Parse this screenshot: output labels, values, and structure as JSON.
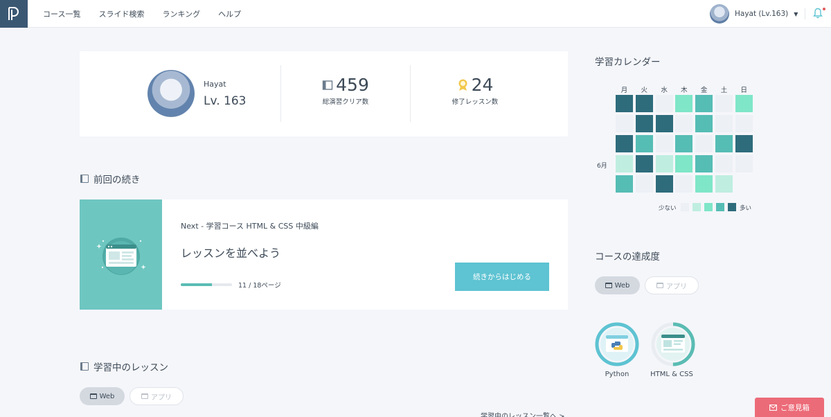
{
  "nav": {
    "items": [
      "コース一覧",
      "スライド検索",
      "ランキング",
      "ヘルプ"
    ]
  },
  "user": {
    "label": "Hayat (Lv.163)"
  },
  "profile": {
    "name": "Hayat",
    "level": "Lv. 163",
    "stats": [
      {
        "value": "459",
        "label": "総演習クリア数"
      },
      {
        "value": "24",
        "label": "修了レッスン数"
      }
    ]
  },
  "continue": {
    "title": "前回の続き",
    "next": "Next - 学習コース HTML & CSS 中級編",
    "lesson": "レッスンを並べよう",
    "progress": 0.6111,
    "pages": "11 / 18ページ",
    "button": "続きからはじめる"
  },
  "learning": {
    "title": "学習中のレッスン",
    "tabs": [
      "Web",
      "アプリ"
    ],
    "more": "学習中のレッスン一覧へ >"
  },
  "calendar": {
    "title": "学習カレンダー",
    "days": [
      "月",
      "火",
      "水",
      "木",
      "金",
      "土",
      "日"
    ],
    "month": "6月",
    "levels": [
      [
        4,
        4,
        0,
        2,
        3,
        0,
        2
      ],
      [
        0,
        4,
        4,
        0,
        3,
        0,
        0
      ],
      [
        4,
        3,
        0,
        3,
        0,
        3,
        4
      ],
      [
        1,
        4,
        1,
        2,
        3,
        0,
        0
      ],
      [
        3,
        0,
        4,
        0,
        2,
        1,
        null
      ]
    ],
    "colors": [
      "#edf0f5",
      "#bfeee0",
      "#7fe6c8",
      "#56bdb5",
      "#2e6c7c"
    ],
    "legend_low": "少ない",
    "legend_high": "多い"
  },
  "achievement": {
    "title": "コースの達成度",
    "tabs": [
      "Web",
      "アプリ"
    ],
    "courses": [
      {
        "name": "Python",
        "progress": 1.0
      },
      {
        "name": "HTML & CSS",
        "progress": 0.5
      }
    ]
  },
  "feedback": {
    "label": "ご意見箱"
  },
  "colors": {
    "accent": "#5ec3d2",
    "brand": "#3b5873",
    "feedback": "#ec6b78"
  }
}
